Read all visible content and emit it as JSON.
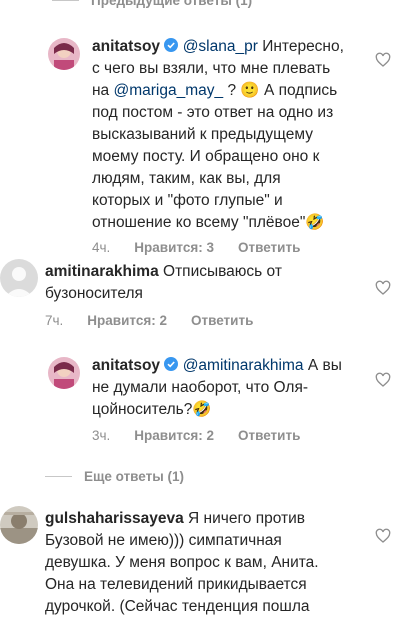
{
  "prev_replies": "Предыдущие ответы (1)",
  "more_replies": "Еще ответы (1)",
  "c1": {
    "username": "anitatsoy",
    "mention1": "@slana_pr",
    "t1": " Интересно,",
    "line2a": "с чего вы взяли, что мне плевать",
    "line3a": "на ",
    "mention2": "@mariga_may_",
    "line3b": " ? 🙂 А подпись",
    "line4": "под постом - это ответ на одно из",
    "line5": "высказываний к предыдущему",
    "line6": "моему посту. И обращено оно к",
    "line7": "людям, таким, как вы, для",
    "line8": "которых и \"фото глупые\" и",
    "line9": "отношение ко всему \"плёвое\"🤣",
    "time": "4ч.",
    "likes": "Нравится: 3",
    "reply": "Ответить"
  },
  "c2": {
    "username": "amitinarakhima",
    "t1": " Отписываюсь от",
    "line2": "бузоносителя",
    "time": "7ч.",
    "likes": "Нравится: 2",
    "reply": "Ответить"
  },
  "c3": {
    "username": "anitatsoy",
    "mention": "@amitinarakhima",
    "t1": " А вы",
    "line2": "не думали наоборот, что Оля-",
    "line3": "цойноситель?🤣",
    "time": "3ч.",
    "likes": "Нравится: 2",
    "reply": "Ответить"
  },
  "c4": {
    "username": "gulshaharissayeva",
    "t1": " Я ничего против",
    "line2": "Бузовой не имею))) симпатичная",
    "line3": "девушка. У меня вопрос к вам, Анита.",
    "line4": "Она на телевидений прикидывается",
    "line5": "дурочкой. (Сейчас тенденция пошла"
  },
  "colors": {
    "text": "#262626",
    "muted": "#8e8e8e",
    "mention": "#00376b",
    "verified": "#3897f0"
  }
}
